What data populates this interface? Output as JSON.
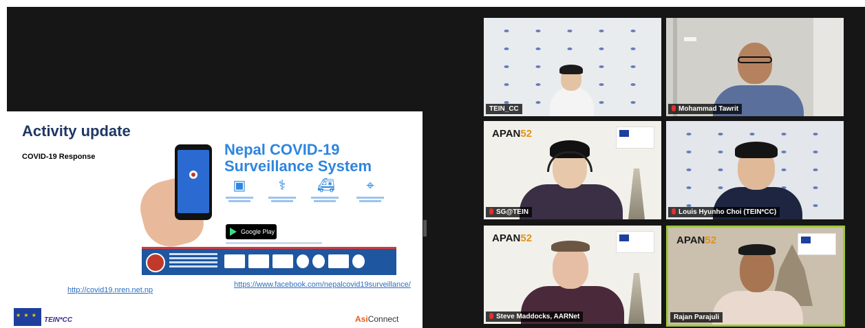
{
  "slide": {
    "title": "Activity update",
    "subtitle": "COVID-19 Response",
    "app_title_line1": "Nepal COVID-19",
    "app_title_line2": "Surveillance System",
    "store_badge": "Google Play",
    "link_website": "http://covid19.nren.net.np",
    "link_facebook": "https://www.facebook.com/nepalcovid19surveillance/",
    "tein_logo": "TEIN*CC",
    "asi_logo_a": "Asi",
    "asi_logo_b": "Connect"
  },
  "participants": [
    {
      "name": "TEIN_CC",
      "muted": false
    },
    {
      "name": "Mohammad Tawrit",
      "muted": true
    },
    {
      "name": "SG@TEIN",
      "muted": true
    },
    {
      "name": "Louis Hyunho Choi (TEIN*CC)",
      "muted": true
    },
    {
      "name": "Steve Maddocks, AARNet",
      "muted": true
    },
    {
      "name": "Rajan Parajuli",
      "muted": false,
      "active_speaker": true
    }
  ],
  "brand": {
    "apan_a": "APAN",
    "apan_b": "52"
  },
  "colors": {
    "active_speaker_border": "#9dc93a",
    "muted_icon": "#e03131",
    "slide_title": "#1f3864",
    "app_title": "#2e86de"
  }
}
